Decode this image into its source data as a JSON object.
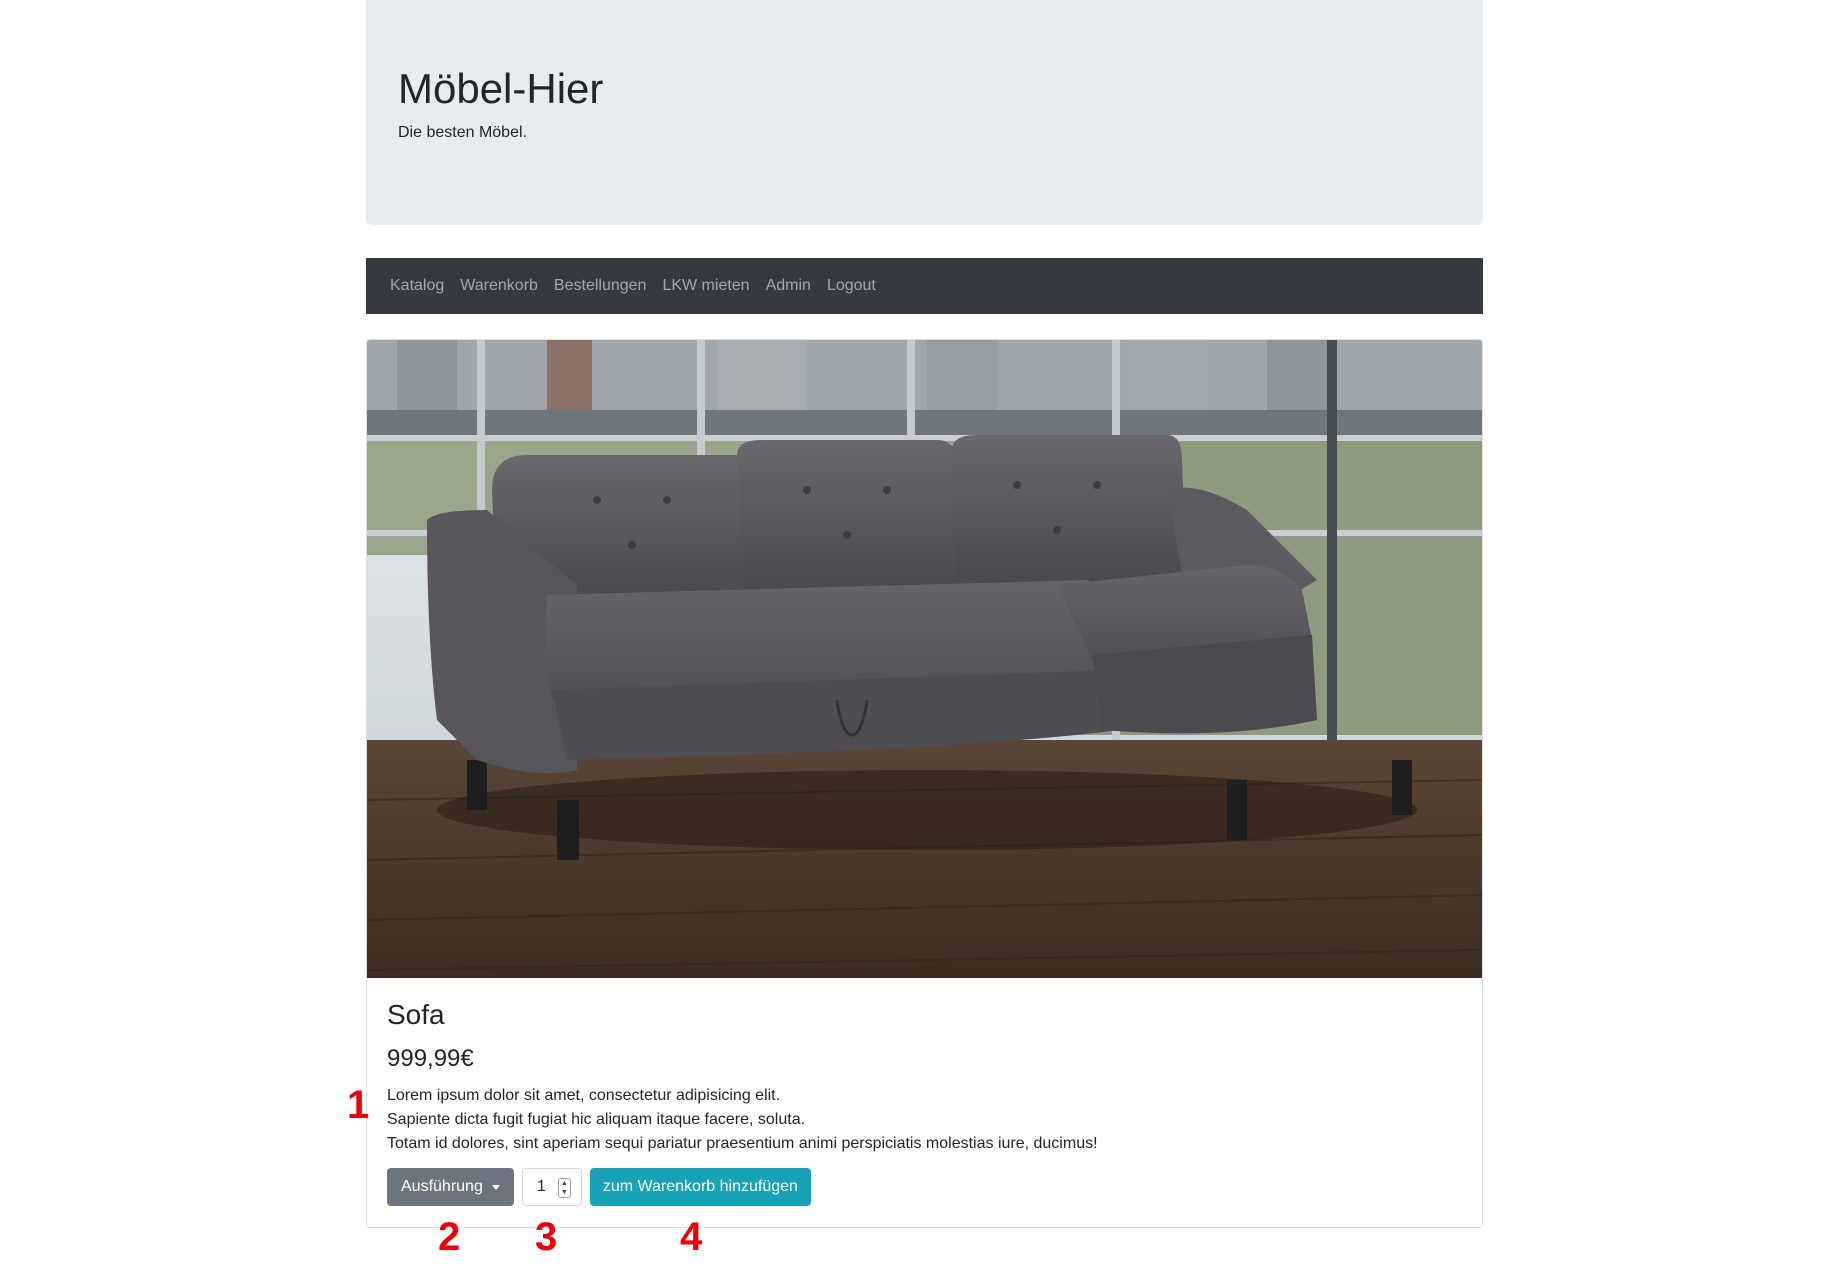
{
  "header": {
    "title": "Möbel-Hier",
    "subtitle": "Die besten Möbel."
  },
  "nav": {
    "items": [
      {
        "label": "Katalog"
      },
      {
        "label": "Warenkorb"
      },
      {
        "label": "Bestellungen"
      },
      {
        "label": "LKW mieten"
      },
      {
        "label": "Admin"
      },
      {
        "label": "Logout"
      }
    ]
  },
  "product": {
    "image_alt": "grey sectional sofa with chaise in a room with large windows",
    "name": "Sofa",
    "price": "999,99€",
    "description": [
      "Lorem ipsum dolor sit amet, consectetur adipisicing elit.",
      "Sapiente dicta fugit fugiat hic aliquam itaque facere, soluta.",
      "Totam id dolores, sint aperiam sequi pariatur praesentium animi perspiciatis molestias iure, ducimus!"
    ],
    "variant_button": "Ausführung",
    "quantity": "1",
    "add_to_cart": "zum Warenkorb hinzufügen"
  },
  "annotations": {
    "m1": "1",
    "m2": "2",
    "m3": "3",
    "m4": "4"
  },
  "colors": {
    "jumbotron_bg": "#e9ecef",
    "navbar_bg": "#343a40",
    "secondary_button": "#6c757d",
    "info_button": "#17a2b8",
    "annotation_red": "#e8000b"
  }
}
